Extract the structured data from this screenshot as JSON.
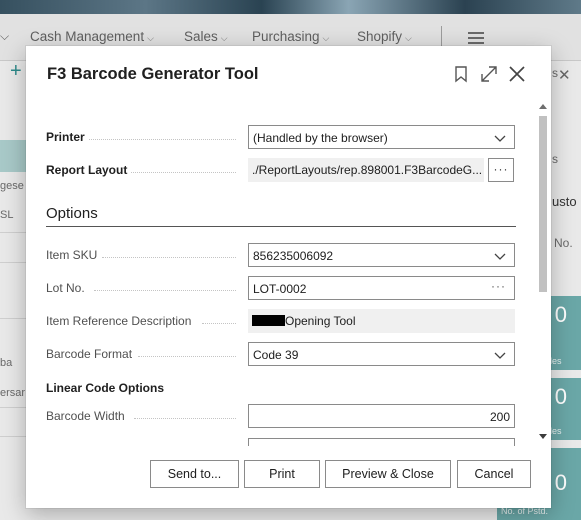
{
  "background": {
    "nav_items": [
      {
        "label": "Cash Management"
      },
      {
        "label": "Sales"
      },
      {
        "label": "Purchasing"
      },
      {
        "label": "Shopify"
      }
    ],
    "left_texts": [
      "gese",
      "SL",
      "ba",
      "ersar"
    ],
    "right_texts": {
      "tab": "s",
      "heading": "usto",
      "col": "No.",
      "partial": "s"
    },
    "tiles": [
      {
        "value": "0",
        "label": "ales"
      },
      {
        "value": "0",
        "label": "ales"
      },
      {
        "value": "0",
        "label": "ales"
      },
      {
        "value": "0",
        "label": "No. of Pstd."
      }
    ],
    "accent": "#6aa7a7"
  },
  "dialog": {
    "title": "F3 Barcode Generator Tool",
    "fields": {
      "printer": {
        "label": "Printer",
        "value": "(Handled by the browser)"
      },
      "report_layout": {
        "label": "Report Layout",
        "value": "./ReportLayouts/rep.898001.F3BarcodeG..."
      },
      "options_header": "Options",
      "item_sku": {
        "label": "Item SKU",
        "value": "856235006092"
      },
      "lot_no": {
        "label": "Lot No.",
        "value": "LOT-0002"
      },
      "item_ref_desc": {
        "label": "Item Reference Description",
        "value": "Opening Tool"
      },
      "barcode_format": {
        "label": "Barcode Format",
        "value": "Code 39"
      },
      "linear_header": "Linear Code Options",
      "barcode_width": {
        "label": "Barcode Width",
        "value": "200"
      }
    },
    "buttons": {
      "send_to": "Send to...",
      "print": "Print",
      "preview_close": "Preview & Close",
      "cancel": "Cancel"
    }
  }
}
